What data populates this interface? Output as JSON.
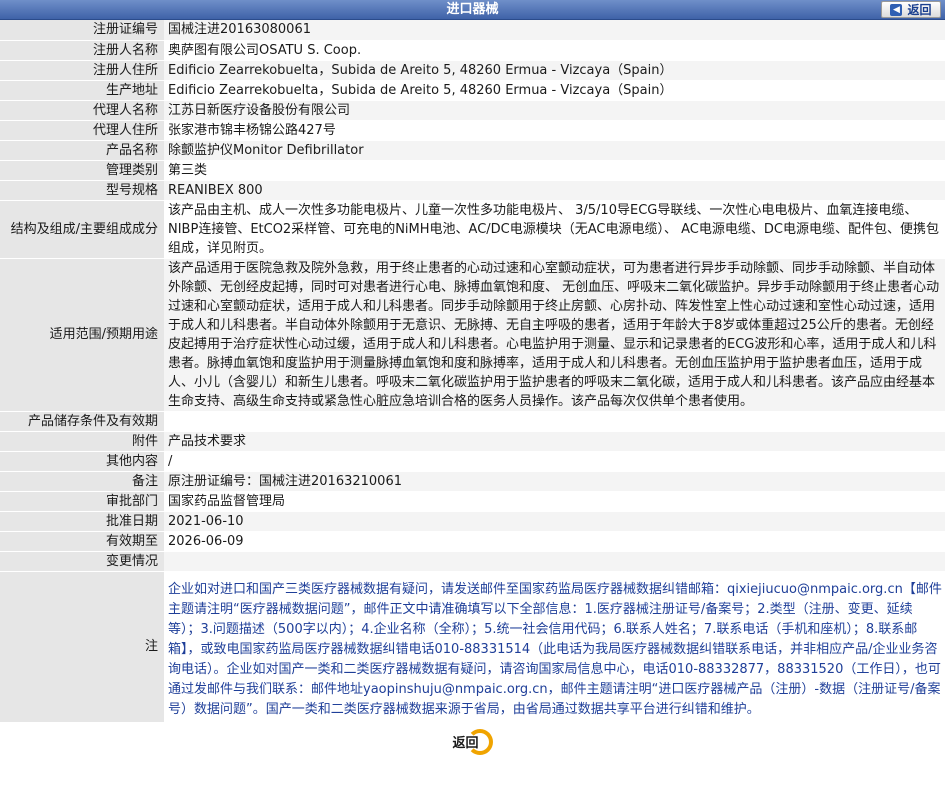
{
  "header": {
    "title": "进口器械",
    "back_label": "返回"
  },
  "rows": [
    {
      "label": "注册证编号",
      "value": "国械注进20163080061"
    },
    {
      "label": "注册人名称",
      "value": "奥萨图有限公司OSATU S. Coop."
    },
    {
      "label": "注册人住所",
      "value": "Edificio Zearrekobuelta，Subida de Areito 5, 48260 Ermua - Vizcaya（Spain）"
    },
    {
      "label": "生产地址",
      "value": "Edificio Zearrekobuelta，Subida de Areito 5, 48260 Ermua - Vizcaya（Spain）"
    },
    {
      "label": "代理人名称",
      "value": "江苏日新医疗设备股份有限公司"
    },
    {
      "label": "代理人住所",
      "value": "张家港市锦丰杨锦公路427号"
    },
    {
      "label": "产品名称",
      "value": "除颤监护仪Monitor Defibrillator"
    },
    {
      "label": "管理类别",
      "value": "第三类"
    },
    {
      "label": "型号规格",
      "value": "REANIBEX 800"
    },
    {
      "label": "结构及组成/主要组成成分",
      "value": "该产品由主机、成人一次性多功能电极片、儿童一次性多功能电极片、 3/5/10导ECG导联线、一次性心电电极片、血氧连接电缆、NIBP连接管、EtCO2采样管、可充电的NiMH电池、AC/DC电源模块（无AC电源电缆）、 AC电源电缆、DC电源电缆、配件包、便携包组成，详见附页。"
    },
    {
      "label": "适用范围/预期用途",
      "value": "该产品适用于医院急救及院外急救，用于终止患者的心动过速和心室颤动症状，可为患者进行异步手动除颤、同步手动除颤、半自动体外除颤、无创经皮起搏，同时可对患者进行心电、脉搏血氧饱和度、 无创血压、呼吸末二氧化碳监护。异步手动除颤用于终止患者心动过速和心室颤动症状，适用于成人和儿科患者。同步手动除颤用于终止房颤、心房扑动、阵发性室上性心动过速和室性心动过速，适用于成人和儿科患者。半自动体外除颤用于无意识、无脉搏、无自主呼吸的患者，适用于年龄大于8岁或体重超过25公斤的患者。无创经皮起搏用于治疗症状性心动过缓，适用于成人和儿科患者。心电监护用于测量、显示和记录患者的ECG波形和心率，适用于成人和儿科患者。脉搏血氧饱和度监护用于测量脉搏血氧饱和度和脉搏率，适用于成人和儿科患者。无创血压监护用于监护患者血压，适用于成人、小儿（含婴儿）和新生儿患者。呼吸末二氧化碳监护用于监护患者的呼吸末二氧化碳，适用于成人和儿科患者。该产品应由经基本生命支持、高级生命支持或紧急性心脏应急培训合格的医务人员操作。该产品每次仅供单个患者使用。"
    },
    {
      "label": "产品储存条件及有效期",
      "value": ""
    },
    {
      "label": "附件",
      "value": "产品技术要求"
    },
    {
      "label": "其他内容",
      "value": "/"
    },
    {
      "label": "备注",
      "value": "原注册证编号：国械注进20163210061"
    },
    {
      "label": "审批部门",
      "value": "国家药品监督管理局"
    },
    {
      "label": "批准日期",
      "value": "2021-06-10"
    },
    {
      "label": "有效期至",
      "value": "2026-06-09"
    },
    {
      "label": "变更情况",
      "value": ""
    }
  ],
  "note": {
    "label": "注",
    "text": "企业如对进口和国产三类医疗器械数据有疑问，请发送邮件至国家药监局医疗器械数据纠错邮箱：qixiejiucuo@nmpaic.org.cn【邮件主题请注明“医疗器械数据问题”，邮件正文中请准确填写以下全部信息：1.医疗器械注册证号/备案号；2.类型（注册、变更、延续等）；3.问题描述（500字以内）；4.企业名称（全称）；5.统一社会信用代码；6.联系人姓名；7.联系电话（手机和座机）；8.联系邮箱】，或致电国家药监局医疗器械数据纠错电话010-88331514（此电话为我局医疗器械数据纠错联系电话，并非相应产品/企业业务咨询电话）。企业如对国产一类和二类医疗器械数据有疑问，请咨询国家局信息中心，电话010-88332877，88331520（工作日），也可通过发邮件与我们联系：邮件地址yaopinshuju@nmpaic.org.cn，邮件主题请注明“进口医疗器械产品（注册）-数据（注册证号/备案号）数据问题”。国产一类和二类医疗器械数据来源于省局，由省局通过数据共享平台进行纠错和维护。"
  },
  "footer": {
    "back_label": "返回"
  }
}
